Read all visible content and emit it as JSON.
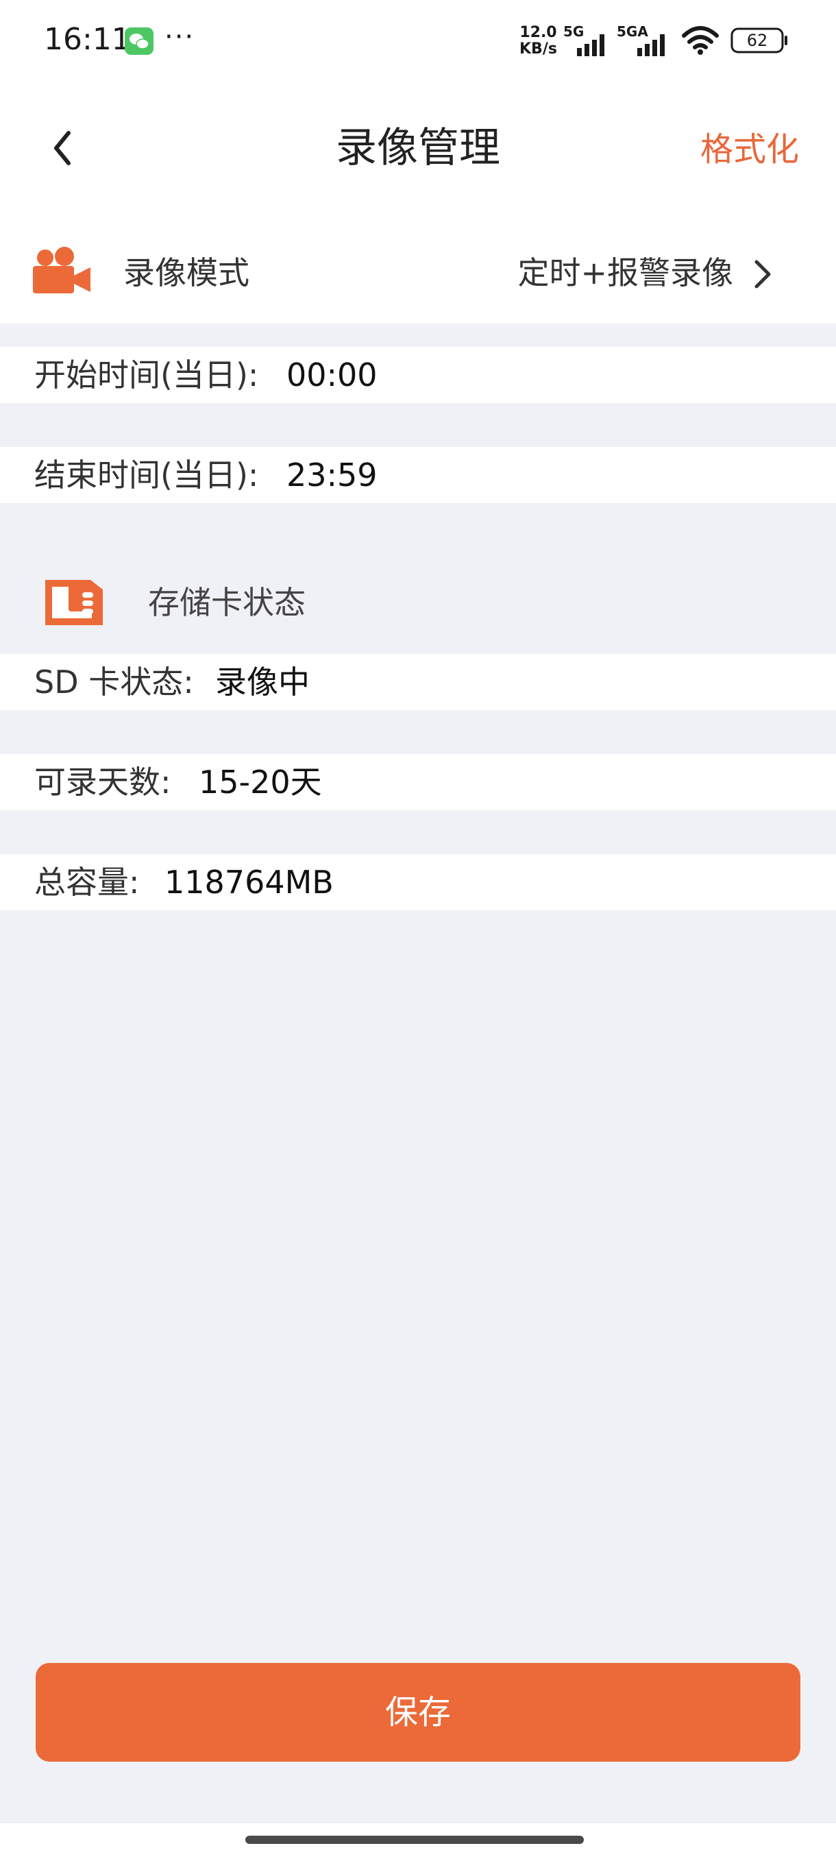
{
  "status_bar": {
    "time": "16:11",
    "more": "···",
    "net_speed_value": "12.0",
    "net_speed_unit": "KB/s",
    "signal_1_label": "5G",
    "signal_2_label": "5GA",
    "battery_level": "62",
    "icons": [
      "wechat-icon",
      "signal-icon",
      "wifi-icon",
      "battery-icon"
    ]
  },
  "header": {
    "back_icon": "chevron-left-icon",
    "title": "录像管理",
    "action": "格式化"
  },
  "recording_mode": {
    "icon": "video-camera-icon",
    "label": "录像模式",
    "value": "定时+报警录像"
  },
  "schedule": {
    "start_label": "开始时间(当日):",
    "start_value": "00:00",
    "end_label": "结束时间(当日):",
    "end_value": "23:59"
  },
  "storage": {
    "icon": "sd-card-icon",
    "title": "存储卡状态",
    "sd_status_label": "SD 卡状态:",
    "sd_status_value": "录像中",
    "days_label": "可录天数:",
    "days_value": "15-20天",
    "capacity_label": "总容量:",
    "capacity_value": "118764MB"
  },
  "footer": {
    "save_label": "保存"
  },
  "colors": {
    "accent": "#eb6a38",
    "background": "#f0f1f6"
  }
}
